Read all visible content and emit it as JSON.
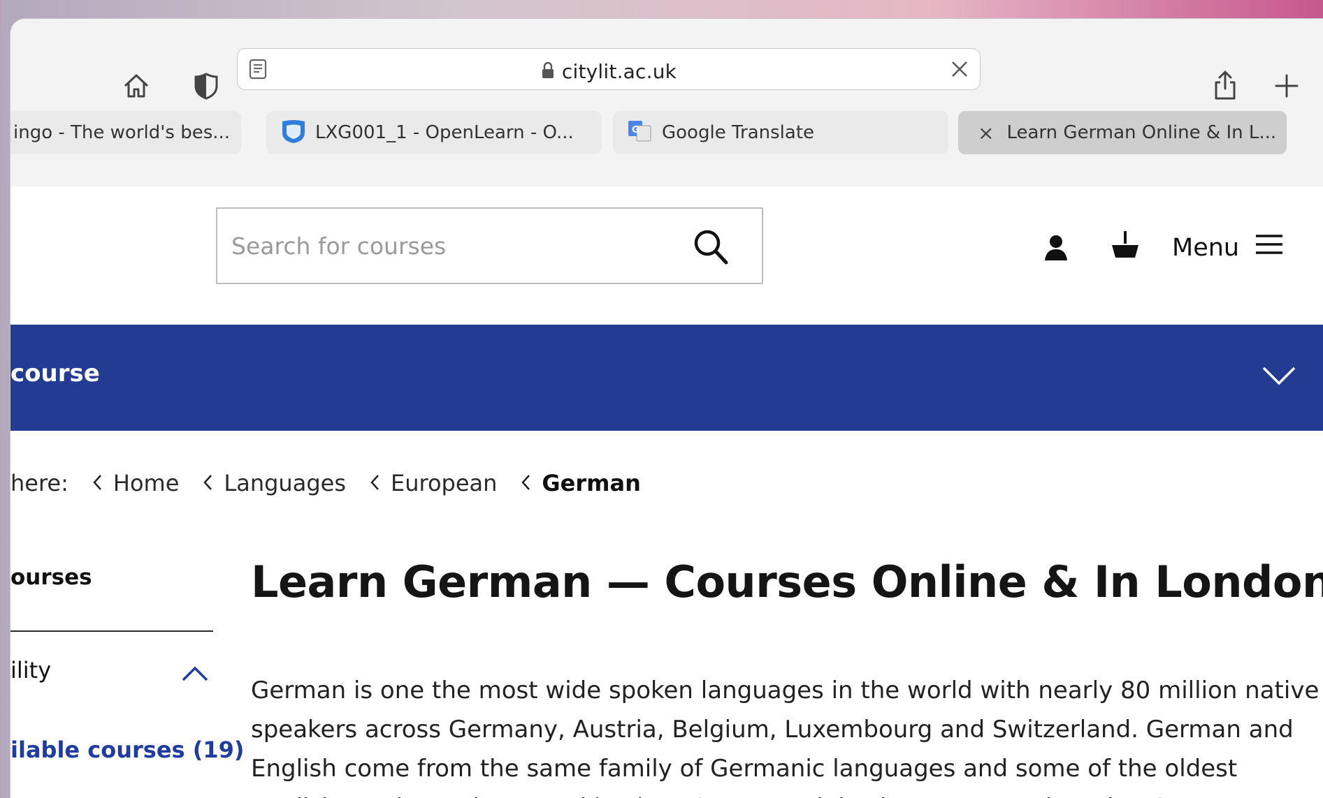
{
  "browser": {
    "url": "citylit.ac.uk",
    "tabs": [
      {
        "title": "ingo - The world's bes..."
      },
      {
        "title": "LXG001_1 - OpenLearn - O..."
      },
      {
        "title": "Google Translate"
      },
      {
        "title": "Learn German Online & In L...",
        "close_glyph": "×"
      }
    ]
  },
  "site": {
    "search_placeholder": "Search for courses",
    "menu_label": "Menu",
    "bar_label": "course",
    "breadcrumb": {
      "prefix": "here:",
      "items": [
        "Home",
        "Languages",
        "European",
        "German"
      ]
    },
    "sidebar": {
      "heading": "ourses",
      "filter_label": "ility",
      "link": "ilable courses (19)",
      "cut_text": "..."
    },
    "title": "Learn German — Courses Online & In London",
    "intro_lines": [
      "German is one the most wide spoken languages in the world with nearly 80 million native",
      "speakers across Germany, Austria, Belgium, Luxembourg and Switzerland. German and",
      "English come from the same family of Germanic languages and some of the oldest",
      "English words can be traced back to German origins but some modern day German"
    ]
  },
  "colors": {
    "brand_blue": "#233b91",
    "link_blue": "#1f3da0"
  },
  "icons": [
    "home-icon",
    "shield-icon",
    "reader-icon",
    "lock-icon",
    "clear-icon",
    "share-icon",
    "new-tab-icon",
    "openlearn-favicon",
    "translate-favicon",
    "search-icon",
    "account-icon",
    "basket-icon",
    "hamburger-icon",
    "chevron-down-icon",
    "chevron-left-icon",
    "chevron-up-icon"
  ]
}
